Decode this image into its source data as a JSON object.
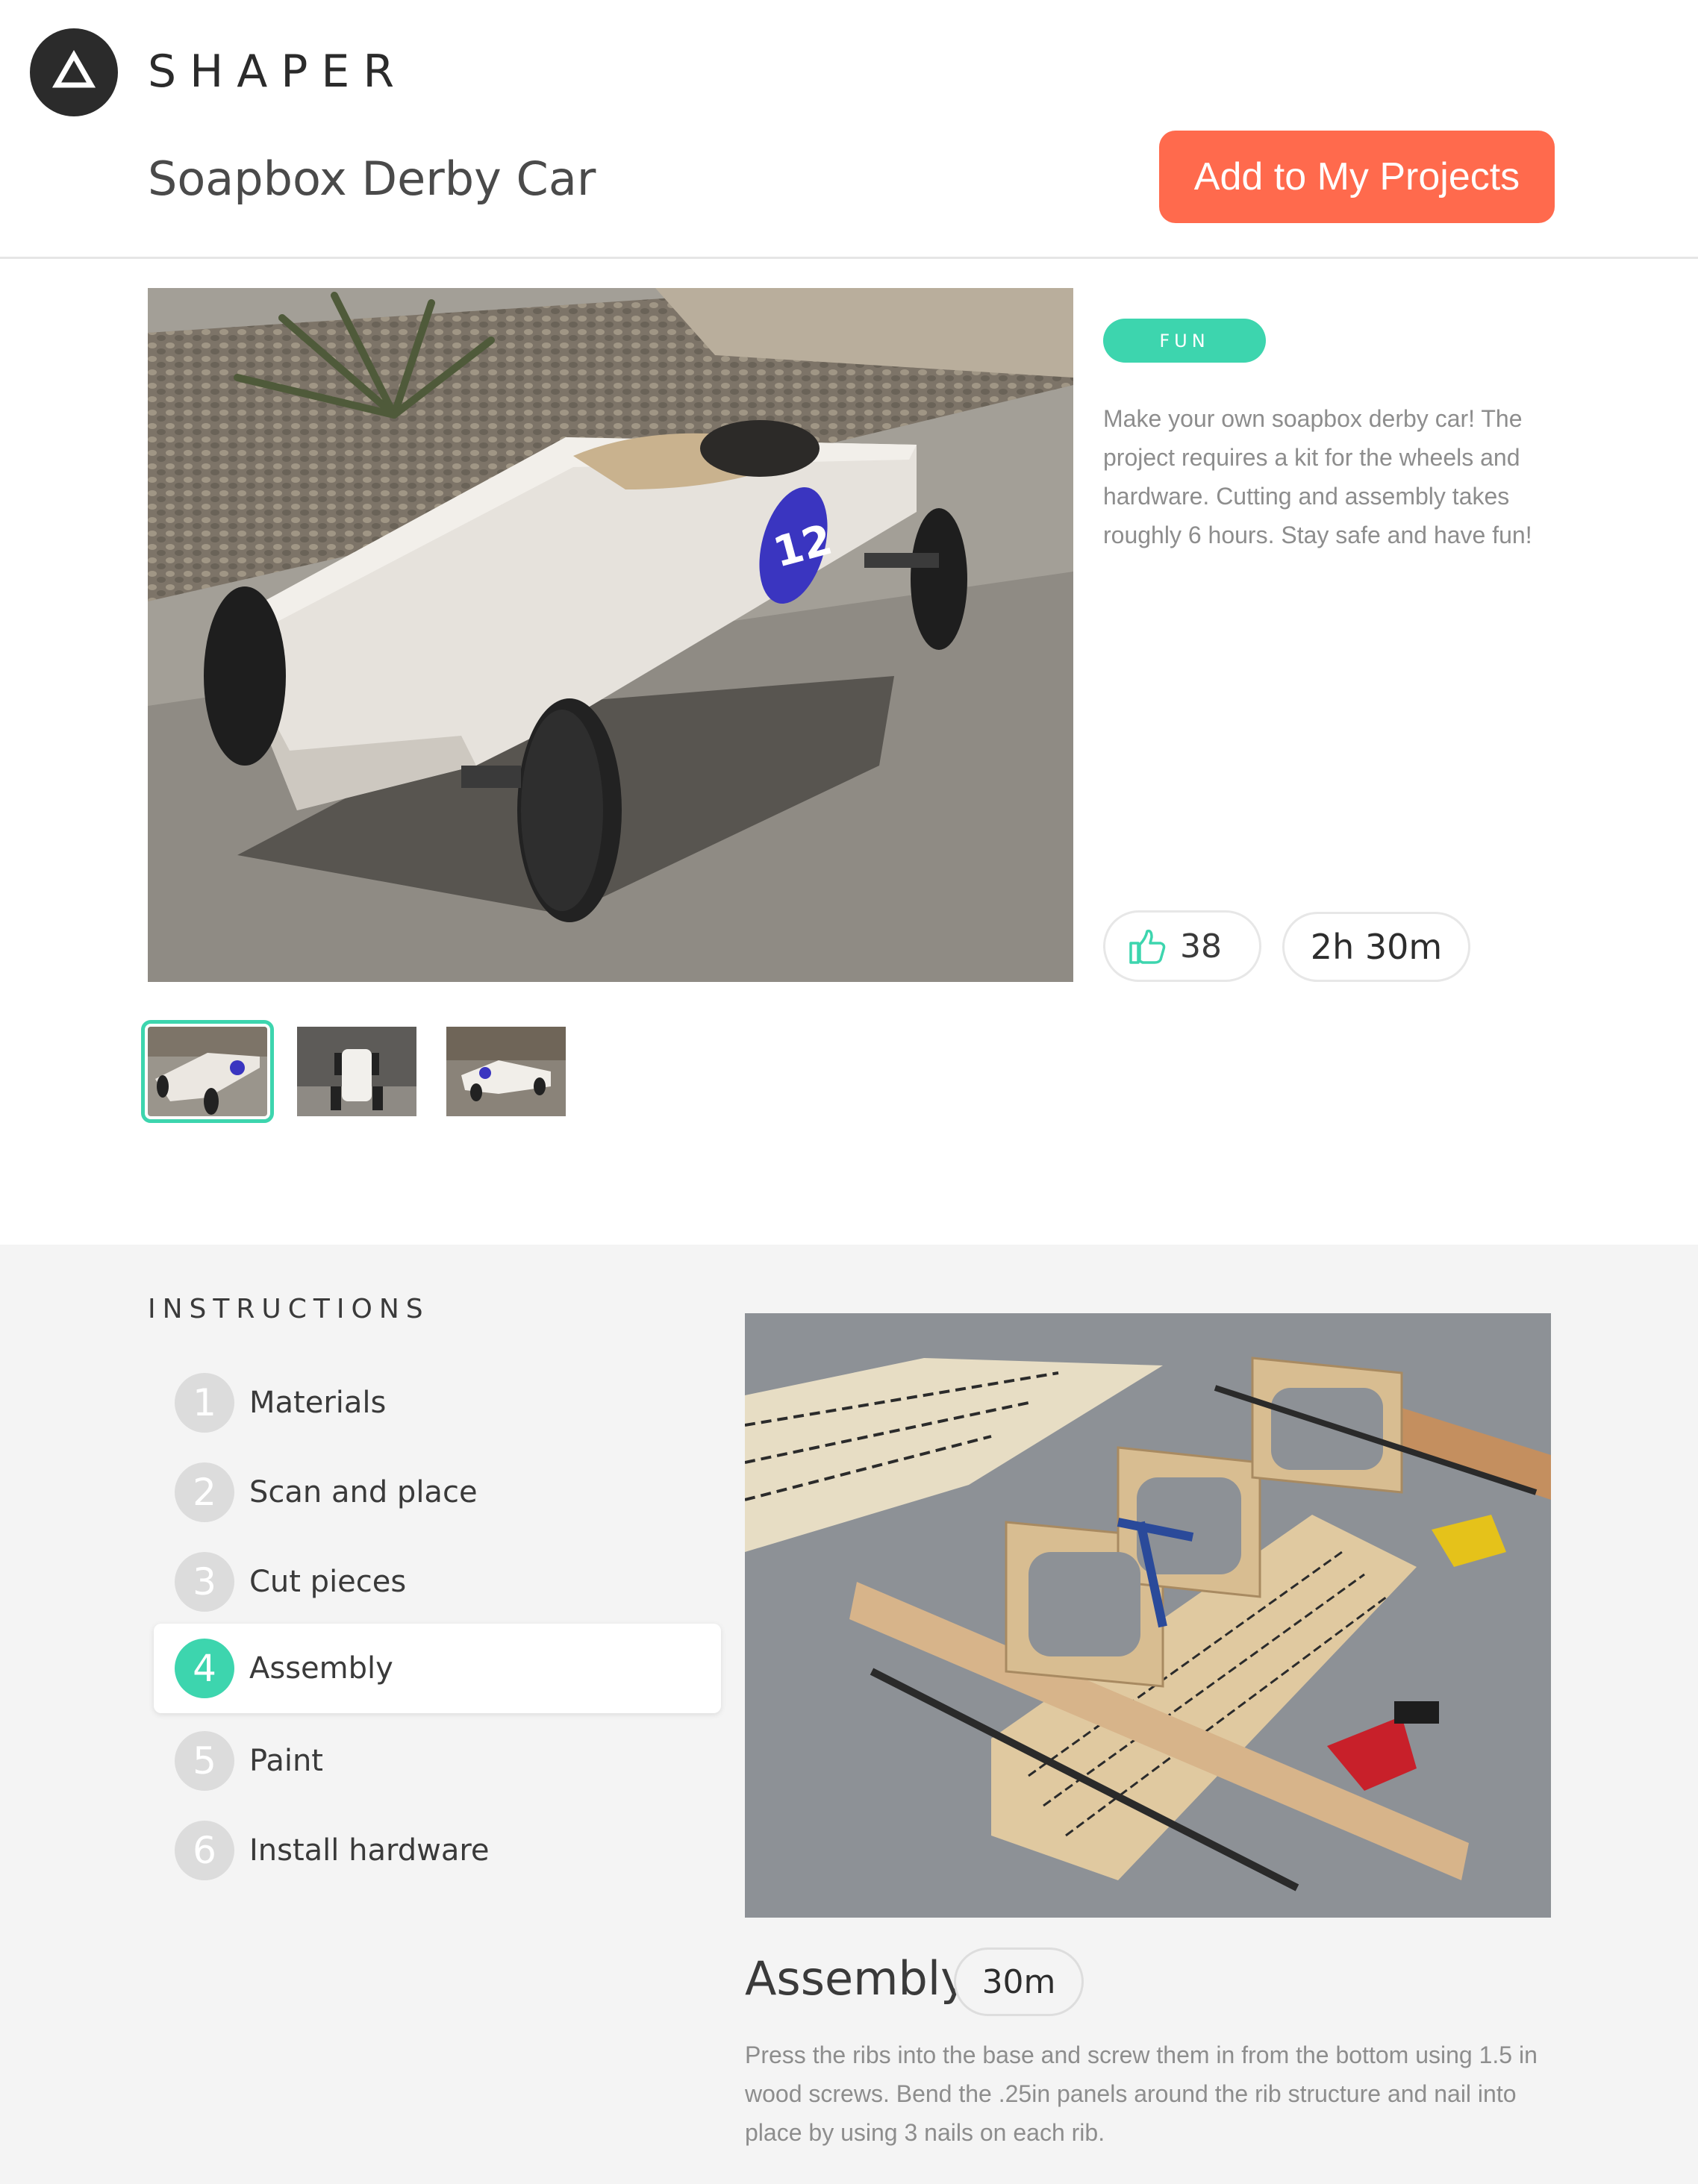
{
  "brand": {
    "name": "SHAPER"
  },
  "project": {
    "title": "Soapbox Derby Car",
    "add_button_label": "Add to My Projects",
    "tag": "FUN",
    "description": "Make your own soapbox derby car! The project requires a kit for the wheels and hardware. Cutting and assembly takes roughly 6 hours. Stay safe and have fun!",
    "likes": "38",
    "duration": "2h 30m"
  },
  "instructions": {
    "heading": "INSTRUCTIONS",
    "steps": [
      {
        "number": "1",
        "label": "Materials"
      },
      {
        "number": "2",
        "label": "Scan and place"
      },
      {
        "number": "3",
        "label": "Cut pieces"
      },
      {
        "number": "4",
        "label": "Assembly"
      },
      {
        "number": "5",
        "label": "Paint"
      },
      {
        "number": "6",
        "label": "Install hardware"
      }
    ],
    "active_step": {
      "title": "Assembly",
      "duration": "30m",
      "description": "Press the ribs into the base and screw them in from the bottom using 1.5 in wood screws. Bend the .25in panels around the rib structure and nail into place by using 3 nails on each rib."
    }
  },
  "colors": {
    "accent": "#3dd5ae",
    "button": "#ff6a4d",
    "section_bg": "#f4f4f4"
  }
}
